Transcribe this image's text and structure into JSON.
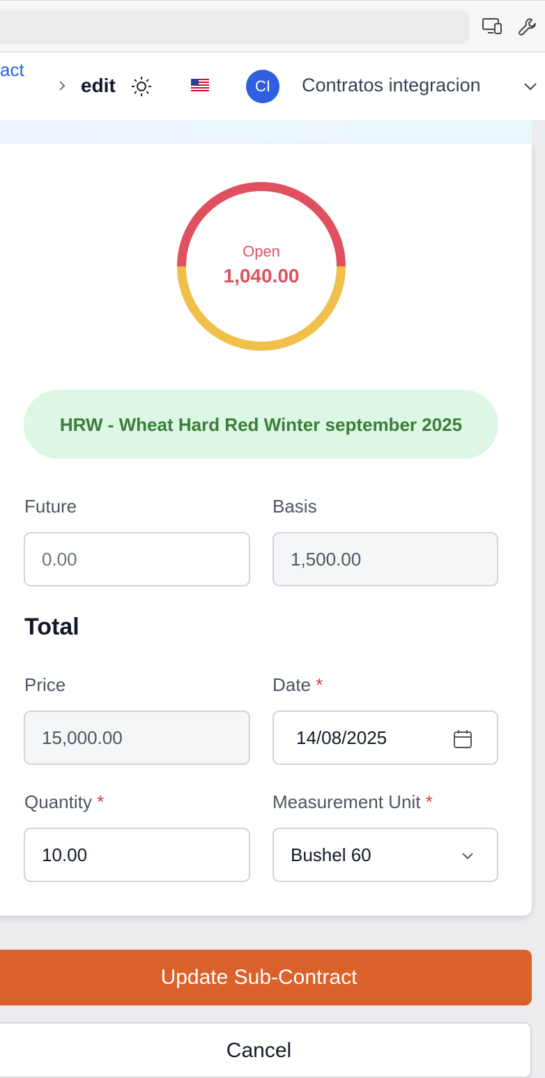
{
  "browser": {
    "devices_icon": "devices-icon",
    "tools_icon": "wrench-icon"
  },
  "header": {
    "breadcrumb_link": "act",
    "breadcrumb_current": "edit",
    "theme_icon": "sun-icon",
    "language_flag": "us-flag-icon",
    "avatar_initials": "CI",
    "org_name": "Contratos integracion",
    "org_chevron_icon": "chevron-down-icon"
  },
  "status": {
    "label": "Open",
    "value": "1,040.00",
    "colors": {
      "open": "#e0505f",
      "filled": "#f0c04a"
    },
    "open_fraction": 0.5
  },
  "product": {
    "name": "HRW - Wheat Hard Red Winter september 2025"
  },
  "form": {
    "future": {
      "label": "Future",
      "placeholder": "0.00",
      "value": ""
    },
    "basis": {
      "label": "Basis",
      "value": "1,500.00"
    },
    "total_title": "Total",
    "price": {
      "label": "Price",
      "value": "15,000.00"
    },
    "date": {
      "label": "Date",
      "required": "*",
      "value": "14/08/2025",
      "icon": "calendar-icon"
    },
    "quantity": {
      "label": "Quantity",
      "required": "*",
      "value": "10.00"
    },
    "unit": {
      "label": "Measurement Unit",
      "required": "*",
      "value": "Bushel 60",
      "icon": "chevron-down-icon"
    }
  },
  "actions": {
    "update_label": "Update Sub-Contract",
    "cancel_label": "Cancel",
    "update_color": "#da612a"
  }
}
